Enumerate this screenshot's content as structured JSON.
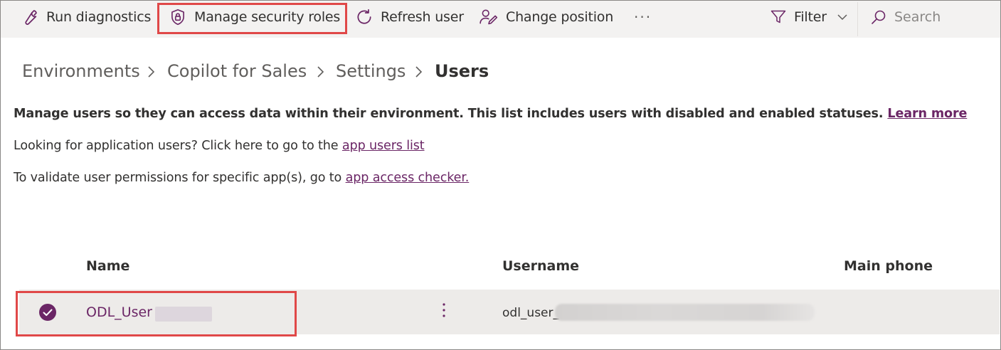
{
  "toolbar": {
    "run_diagnostics": "Run diagnostics",
    "manage_security_roles": "Manage security roles",
    "refresh_user": "Refresh user",
    "change_position": "Change position",
    "more": "···",
    "filter": "Filter",
    "search_placeholder": "Search"
  },
  "breadcrumb": {
    "items": [
      "Environments",
      "Copilot for Sales",
      "Settings"
    ],
    "current": "Users"
  },
  "intro": {
    "main_text": "Manage users so they can access data within their environment. This list includes users with disabled and enabled statuses.",
    "learn_more": "Learn more",
    "app_users_text": "Looking for application users? Click here to go to the",
    "app_users_link": "app users list",
    "validate_text": "To validate user permissions for specific app(s), go to",
    "validate_link": "app access checker."
  },
  "table": {
    "columns": [
      "Name",
      "Username",
      "Main phone"
    ],
    "rows": [
      {
        "name": "ODL_User",
        "username": "odl_user_",
        "main_phone": "",
        "selected": true
      }
    ]
  },
  "colors": {
    "accent": "#6b2666",
    "highlight": "#e04848",
    "toolbar_bg": "#f3f2f1",
    "row_bg": "#edebe9"
  }
}
